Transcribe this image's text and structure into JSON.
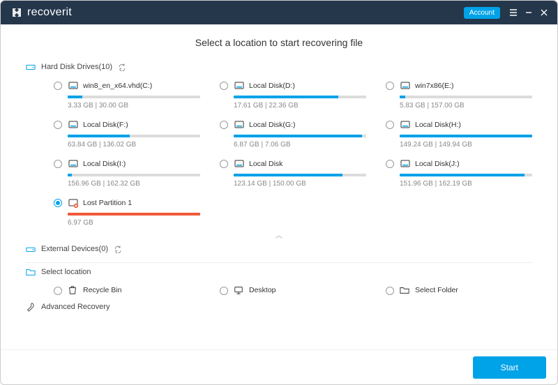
{
  "title": "Select a location to start recovering file",
  "brand": "recoverit",
  "titlebar": {
    "account": "Account"
  },
  "sections": {
    "hdd_label_prefix": "Hard Disk Drives",
    "hdd_count": 10,
    "ext_label_prefix": "External Devices",
    "ext_count": 0,
    "select_location": "Select location",
    "advanced_recovery": "Advanced Recovery"
  },
  "drives": [
    {
      "label": "win8_en_x64.vhd(C:)",
      "used": "3.33",
      "total": "30.00",
      "pct": 11,
      "lost": false,
      "selected": false
    },
    {
      "label": "Local Disk(D:)",
      "used": "17.61",
      "total": "22.36",
      "pct": 79,
      "lost": false,
      "selected": false
    },
    {
      "label": "win7x86(E:)",
      "used": "5.83",
      "total": "157.00",
      "pct": 4,
      "lost": false,
      "selected": false
    },
    {
      "label": "Local Disk(F:)",
      "used": "63.84",
      "total": "136.02",
      "pct": 47,
      "lost": false,
      "selected": false
    },
    {
      "label": "Local Disk(G:)",
      "used": "6.87",
      "total": "7.06",
      "pct": 97,
      "lost": false,
      "selected": false
    },
    {
      "label": "Local Disk(H:)",
      "used": "149.24",
      "total": "149.94",
      "pct": 100,
      "lost": false,
      "selected": false
    },
    {
      "label": "Local Disk(I:)",
      "used": "156.96",
      "total": "162.32",
      "pct": 3,
      "lost": false,
      "selected": false
    },
    {
      "label": "Local Disk",
      "used": "123.14",
      "total": "150.00",
      "pct": 82,
      "lost": false,
      "selected": false
    },
    {
      "label": "Local Disk(J:)",
      "used": "151.96",
      "total": "162.19",
      "pct": 94,
      "lost": false,
      "selected": false
    },
    {
      "label": "Lost Partition 1",
      "used": "6.97",
      "total": "",
      "pct": 100,
      "lost": true,
      "selected": true
    }
  ],
  "size_unit": "GB",
  "locations": [
    {
      "label": "Recycle Bin"
    },
    {
      "label": "Desktop"
    },
    {
      "label": "Select Folder"
    }
  ],
  "start_button": "Start",
  "colors": {
    "accent": "#00a2e8",
    "lost": "#f1593a"
  }
}
